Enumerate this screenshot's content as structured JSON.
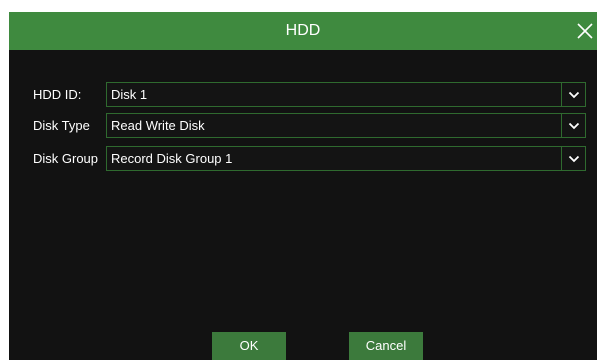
{
  "dialog": {
    "title": "HDD",
    "close_icon": "close-icon",
    "accent_color": "#3f8a3f"
  },
  "fields": [
    {
      "label": "HDD ID:",
      "value": "Disk 1"
    },
    {
      "label": "Disk Type",
      "value": "Read Write Disk"
    },
    {
      "label": "Disk Group",
      "value": "Record Disk Group 1"
    }
  ],
  "buttons": {
    "ok_label": "OK",
    "cancel_label": "Cancel"
  }
}
